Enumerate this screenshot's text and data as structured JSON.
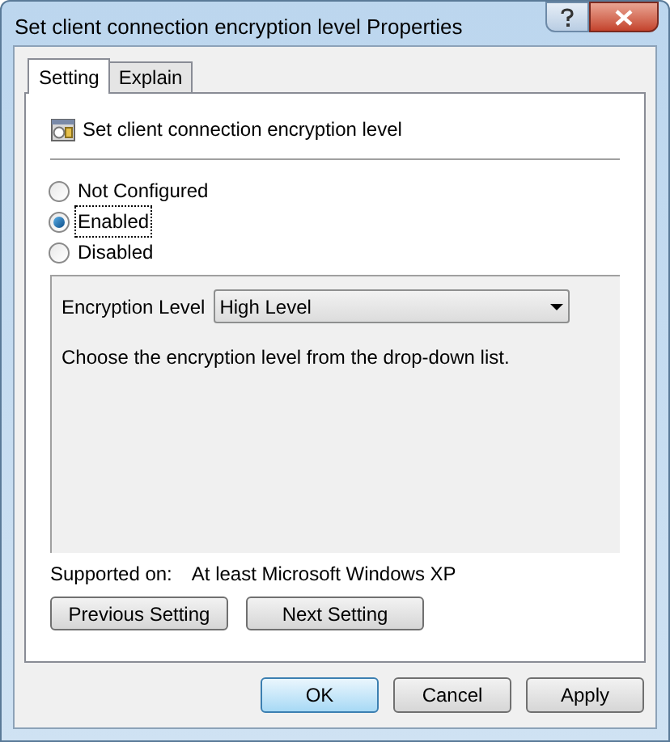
{
  "window": {
    "title": "Set client connection encryption level Properties"
  },
  "tabs": [
    {
      "label": "Setting",
      "selected": true
    },
    {
      "label": "Explain",
      "selected": false
    }
  ],
  "policy": {
    "name": "Set client connection encryption level"
  },
  "options": [
    {
      "label": "Not Configured",
      "selected": false
    },
    {
      "label": "Enabled",
      "selected": true
    },
    {
      "label": "Disabled",
      "selected": false
    }
  ],
  "options_panel": {
    "field_label": "Encryption Level",
    "value": "High Level",
    "description": "Choose the encryption level from the drop-down list."
  },
  "supported_on": {
    "label": "Supported on:",
    "value": "At least Microsoft Windows XP"
  },
  "nav_buttons": [
    "Previous Setting",
    "Next Setting"
  ],
  "buttons": [
    {
      "label": "OK",
      "kind": "default"
    },
    {
      "label": "Cancel",
      "kind": "normal"
    },
    {
      "label": "Apply",
      "kind": "normal"
    }
  ]
}
